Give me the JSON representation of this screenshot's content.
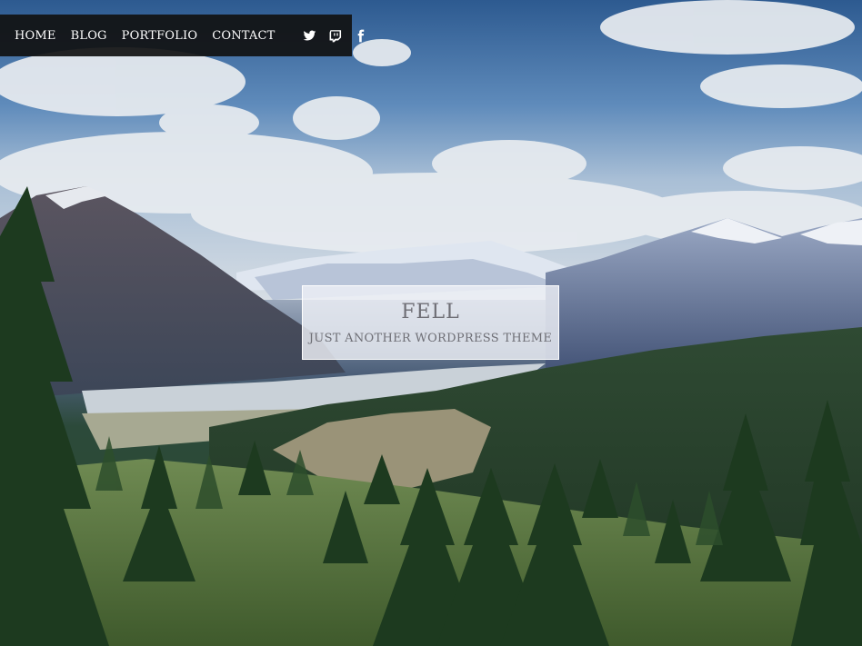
{
  "nav": {
    "items": [
      {
        "label": "HOME"
      },
      {
        "label": "BLOG"
      },
      {
        "label": "PORTFOLIO"
      },
      {
        "label": "CONTACT"
      }
    ],
    "social": [
      {
        "icon": "twitter-icon"
      },
      {
        "icon": "twitch-icon"
      },
      {
        "icon": "facebook-icon"
      }
    ]
  },
  "branding": {
    "title": "FELL",
    "description": "JUST ANOTHER WORDPRESS THEME"
  },
  "colors": {
    "nav_background": "#111111",
    "nav_text": "#ffffff",
    "branding_text": "#6e6e75",
    "branding_background": "#eef0f6"
  }
}
